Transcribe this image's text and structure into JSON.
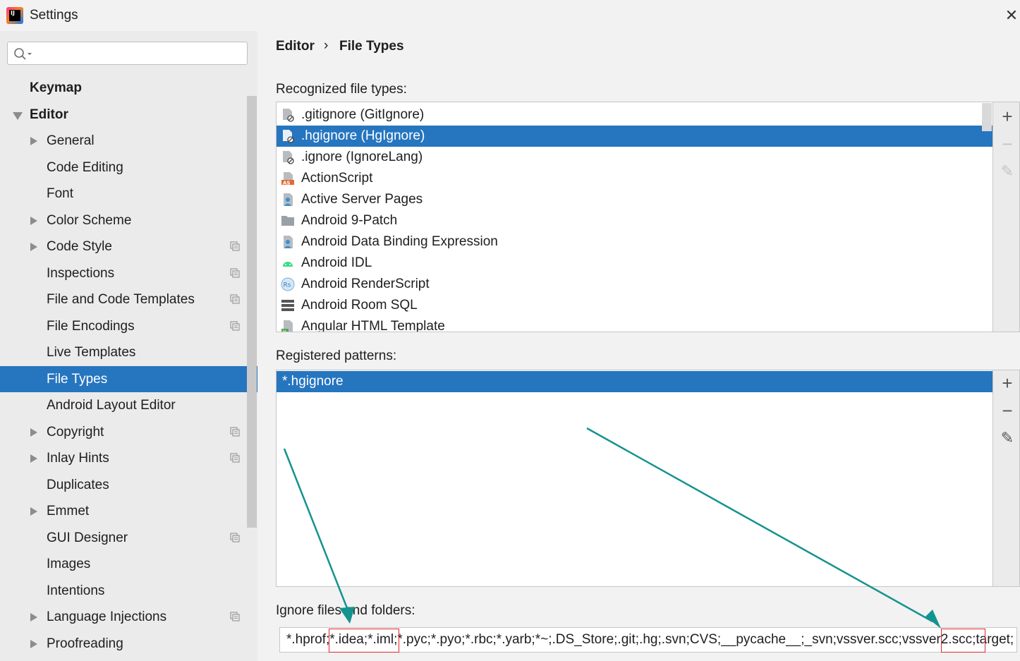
{
  "window": {
    "title": "Settings",
    "close": "✕"
  },
  "breadcrumb": {
    "parent": "Editor",
    "separator": "›",
    "current": "File Types"
  },
  "sidebar": {
    "search_placeholder": "",
    "items": [
      {
        "label": "Keymap",
        "bold": true,
        "arrow": "none",
        "copy": false,
        "selected": false
      },
      {
        "label": "Editor",
        "bold": true,
        "arrow": "down",
        "copy": false,
        "selected": false
      },
      {
        "label": "General",
        "arrow": "right",
        "copy": false,
        "selected": false
      },
      {
        "label": "Code Editing",
        "arrow": "none",
        "copy": false,
        "selected": false
      },
      {
        "label": "Font",
        "arrow": "none",
        "copy": false,
        "selected": false
      },
      {
        "label": "Color Scheme",
        "arrow": "right",
        "copy": false,
        "selected": false
      },
      {
        "label": "Code Style",
        "arrow": "right",
        "copy": true,
        "selected": false
      },
      {
        "label": "Inspections",
        "arrow": "none",
        "copy": true,
        "selected": false
      },
      {
        "label": "File and Code Templates",
        "arrow": "none",
        "copy": true,
        "selected": false
      },
      {
        "label": "File Encodings",
        "arrow": "none",
        "copy": true,
        "selected": false
      },
      {
        "label": "Live Templates",
        "arrow": "none",
        "copy": false,
        "selected": false
      },
      {
        "label": "File Types",
        "arrow": "none",
        "copy": false,
        "selected": true
      },
      {
        "label": "Android Layout Editor",
        "arrow": "none",
        "copy": false,
        "selected": false
      },
      {
        "label": "Copyright",
        "arrow": "right",
        "copy": true,
        "selected": false
      },
      {
        "label": "Inlay Hints",
        "arrow": "right",
        "copy": true,
        "selected": false
      },
      {
        "label": "Duplicates",
        "arrow": "none",
        "copy": false,
        "selected": false
      },
      {
        "label": "Emmet",
        "arrow": "right",
        "copy": false,
        "selected": false
      },
      {
        "label": "GUI Designer",
        "arrow": "none",
        "copy": true,
        "selected": false
      },
      {
        "label": "Images",
        "arrow": "none",
        "copy": false,
        "selected": false
      },
      {
        "label": "Intentions",
        "arrow": "none",
        "copy": false,
        "selected": false
      },
      {
        "label": "Language Injections",
        "arrow": "right",
        "copy": true,
        "selected": false
      },
      {
        "label": "Proofreading",
        "arrow": "right",
        "copy": false,
        "selected": false
      }
    ]
  },
  "recognized": {
    "label": "Recognized file types:",
    "items": [
      {
        "label": ".gitignore (GitIgnore)",
        "icon": "ignore-file-icon",
        "selected": false
      },
      {
        "label": ".hgignore (HgIgnore)",
        "icon": "ignore-file-icon",
        "selected": true
      },
      {
        "label": ".ignore (IgnoreLang)",
        "icon": "ignore-file-icon",
        "selected": false
      },
      {
        "label": "ActionScript",
        "icon": "actionscript-icon",
        "selected": false
      },
      {
        "label": "Active Server Pages",
        "icon": "asp-icon",
        "selected": false
      },
      {
        "label": "Android 9-Patch",
        "icon": "folder-icon",
        "selected": false
      },
      {
        "label": "Android Data Binding Expression",
        "icon": "asp-icon",
        "selected": false
      },
      {
        "label": "Android IDL",
        "icon": "android-icon",
        "selected": false
      },
      {
        "label": "Android RenderScript",
        "icon": "renderscript-icon",
        "selected": false
      },
      {
        "label": "Android Room SQL",
        "icon": "database-icon",
        "selected": false
      },
      {
        "label": "Angular HTML Template",
        "icon": "html-file-icon",
        "selected": false
      }
    ]
  },
  "patterns": {
    "label": "Registered patterns:",
    "items": [
      "*.hgignore"
    ]
  },
  "ignore": {
    "label": "Ignore files and folders:",
    "value": "*.hprof;*.idea;*.iml;*.pyc;*.pyo;*.rbc;*.yarb;*~;.DS_Store;.git;.hg;.svn;CVS;__pycache__;_svn;vssver.scc;vssver2.scc;target;"
  },
  "tools": {
    "add": "+",
    "remove": "−",
    "edit": "✎"
  },
  "colors": {
    "selection": "#2675bf",
    "annotation_arrow": "#14938f",
    "annotation_box": "#e0252b"
  }
}
